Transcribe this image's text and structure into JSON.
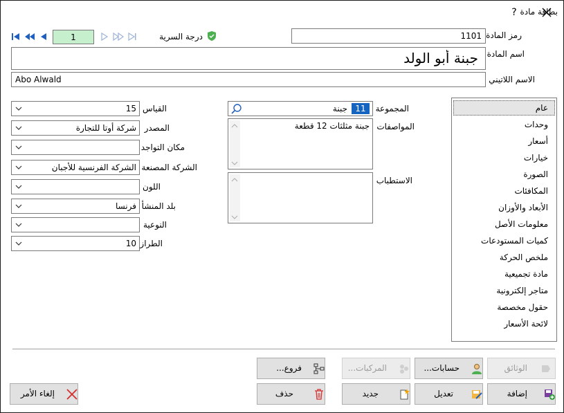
{
  "window": {
    "title": "بطاقة مادة",
    "help_label": "?",
    "close_label": "✕"
  },
  "nav": {
    "record_number": "1",
    "security_label": "درجة السرية"
  },
  "fields": {
    "code_label": "رمز المادة",
    "code_value": "1101",
    "name_label": "اسم المادة",
    "name_value": "جبنة أبو الولد",
    "latin_label": "الاسم اللاتيني",
    "latin_value": "Abo Alwald",
    "group_label": "المجموعة",
    "group_code": "11",
    "group_name": "جبنة",
    "specs_label": "المواصفات",
    "specs_value": "جبنة مثلثات 12 قطعة",
    "storage_label": "الاستطباب",
    "storage_value": ""
  },
  "left_fields": [
    {
      "label": "القياس",
      "value": "15"
    },
    {
      "label": "المصدر",
      "value": "شركة أوتا للتجارة"
    },
    {
      "label": "مكان التواجد",
      "value": ""
    },
    {
      "label": "الشركة المصنعة",
      "value": "الشركة الفرنسية للأجبان"
    },
    {
      "label": "اللون",
      "value": ""
    },
    {
      "label": "بلد المنشأ",
      "value": "فرنسا"
    },
    {
      "label": "النوعية",
      "value": ""
    },
    {
      "label": "الطراز",
      "value": "10"
    }
  ],
  "categories": [
    "عام",
    "وحدات",
    "أسعار",
    "خيارات",
    "الصورة",
    "المكافئات",
    "الأبعاد والأوزان",
    "معلومات الأصل",
    "كميات المستودعات",
    "ملخص الحركة",
    "مادة تجميعية",
    "متاجر إلكترونية",
    "حقول مخصصة",
    "لائحة الأسعار"
  ],
  "selected_category": "عام",
  "buttons": {
    "documents": "الوثائق",
    "accounts": "حسابات...",
    "components": "المركبات...",
    "branches": "فروع...",
    "add": "إضافة",
    "edit": "تعديل",
    "new": "جديد",
    "delete": "حذف",
    "cancel": "إلغاء الأمر"
  },
  "colors": {
    "record_bg": "#c6efce",
    "group_badge": "#1565c0",
    "shield": "#4caf50",
    "nav_blue": "#1f5fbf",
    "delete_red": "#d32f2f"
  }
}
